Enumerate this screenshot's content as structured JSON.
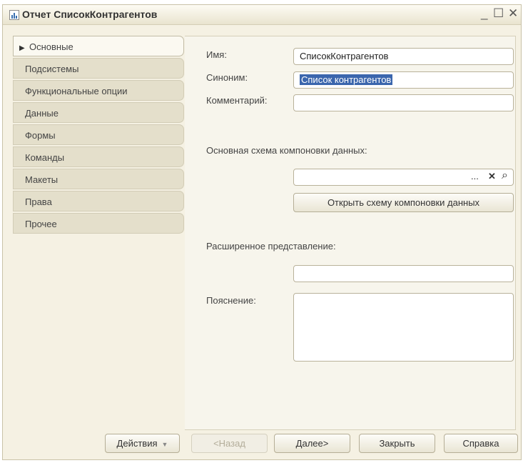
{
  "window": {
    "title": "Отчет СписокКонтрагентов",
    "min": "_",
    "max": "☐",
    "close": "✕"
  },
  "sidebar": {
    "items": [
      {
        "label": "Основные",
        "marker": "▶"
      },
      {
        "label": "Подсистемы"
      },
      {
        "label": "Функциональные опции"
      },
      {
        "label": "Данные"
      },
      {
        "label": "Формы"
      },
      {
        "label": "Команды"
      },
      {
        "label": "Макеты"
      },
      {
        "label": "Права"
      },
      {
        "label": "Прочее"
      }
    ]
  },
  "form": {
    "name_label": "Имя:",
    "name_value": "СписокКонтрагентов",
    "synonym_label": "Синоним:",
    "synonym_value": "Список контрагентов",
    "comment_label": "Комментарий:",
    "comment_value": "",
    "schema_label": "Основная схема компоновки данных:",
    "schema_value": "",
    "schema_btn_dots": "...",
    "schema_btn_clear": "✕",
    "schema_btn_search": "⌕",
    "open_schema_button": "Открыть схему компоновки данных",
    "extended_label": "Расширенное представление:",
    "extended_value": "",
    "explanation_label": "Пояснение:",
    "explanation_value": ""
  },
  "footer": {
    "actions": "Действия",
    "actions_caret": "▼",
    "back": "<Назад",
    "next": "Далее>",
    "close": "Закрыть",
    "help": "Справка"
  }
}
